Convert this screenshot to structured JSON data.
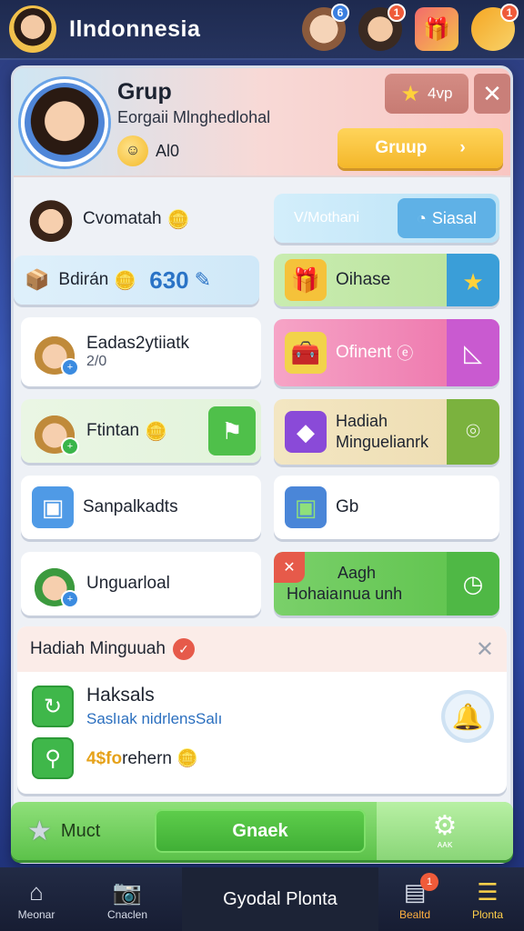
{
  "topbar": {
    "title": "Ilndonnesia",
    "icon_badges": [
      "6",
      "1",
      "",
      "1"
    ]
  },
  "header": {
    "title": "Grup",
    "subtitle": "Eorgaii Mlnghedlohal",
    "points": "Al0",
    "vip_label": "4vp",
    "group_button": "Gruup",
    "group_button_arrow": "›"
  },
  "grid": {
    "r1_left": "Cvomatah",
    "r1_right_a": "V/Mothani",
    "r1_right_b": "Siasal",
    "r2_left_label": "Bdirán",
    "r2_left_value": "630",
    "r2_right": "Oihase",
    "r3_left_title": "Eadas2ytiiatk",
    "r3_left_sub": "2/0",
    "r3_right": "Ofinent",
    "r4_left": "Ftintan",
    "r4_right_a": "Hadiah",
    "r4_right_b": "Minguelianrk",
    "r5_left": "Sanpalkadts",
    "r5_right": "Gb",
    "r6_left": "Unguarloal",
    "r6_right_a": "Aagh",
    "r6_right_b": "Hohaiaınua unh"
  },
  "rewards": {
    "title": "Hadiah Minguuah",
    "item_title": "Haksals",
    "item_sub": "Saslıak nidrlensSalı",
    "amount_gold": "4$fo",
    "amount_rest": "rehern"
  },
  "actionbar": {
    "left_label": "Muct",
    "main_label": "Gnaek",
    "gear_label": "ᴀᴀᴋ"
  },
  "nav": {
    "item1": "Meonar",
    "item2": "Cnaclen",
    "center": "Gyodal Plonta",
    "item3": "Bealtd",
    "item3_badge": "1",
    "item4": "Plonta"
  },
  "colors": {
    "accent_yellow": "#f4b72a",
    "accent_green": "#5cc24a",
    "accent_pink": "#e8579a",
    "accent_blue": "#3b8be0",
    "topbar_bg": "#1e2a4f"
  }
}
